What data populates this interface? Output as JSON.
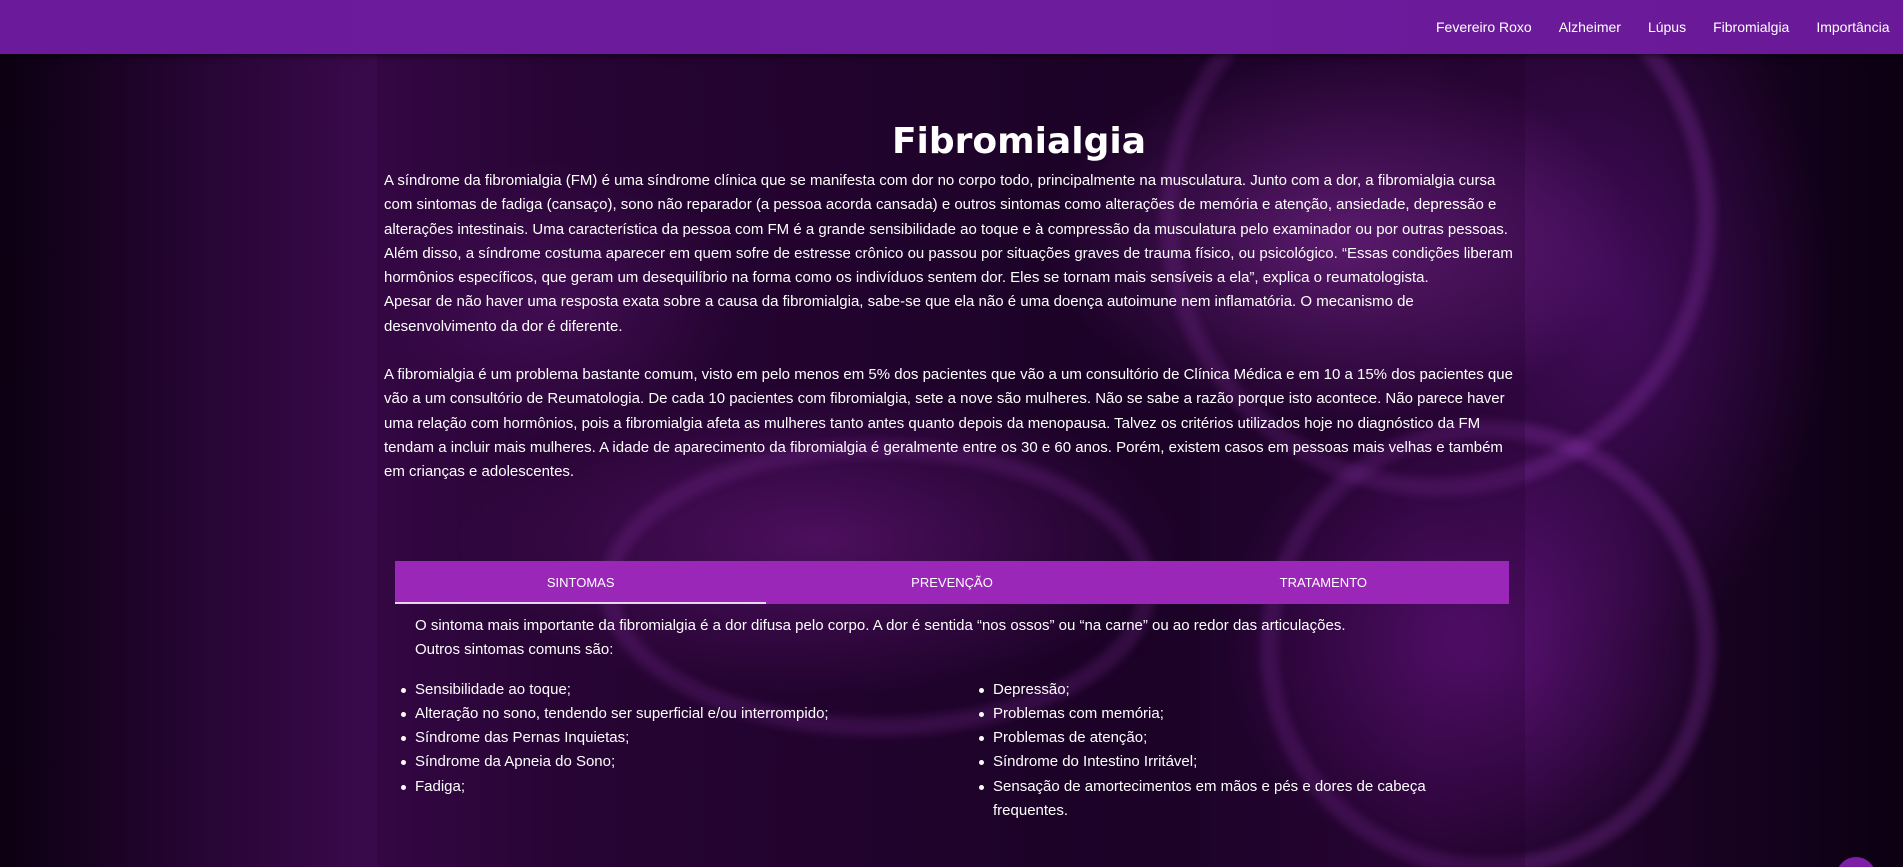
{
  "nav": {
    "items": [
      {
        "label": "Fevereiro Roxo"
      },
      {
        "label": "Alzheimer"
      },
      {
        "label": "Lúpus"
      },
      {
        "label": "Fibromialgia"
      },
      {
        "label": "Importância"
      }
    ]
  },
  "page": {
    "title": "Fibromialgia",
    "paragraphs": [
      "A síndrome da fibromialgia (FM) é uma síndrome clínica que se manifesta com dor no corpo todo, principalmente na musculatura. Junto com a dor, a fibromialgia cursa com sintomas de fadiga (cansaço), sono não reparador (a pessoa acorda cansada) e outros sintomas como alterações de memória e atenção, ansiedade, depressão e alterações intestinais. Uma característica da pessoa com FM é a grande sensibilidade ao toque e à compressão da musculatura pelo examinador ou por outras pessoas.",
      "Além disso, a síndrome costuma aparecer em quem sofre de estresse crônico ou passou por situações graves de trauma físico, ou psicológico. “Essas condições liberam hormônios específicos, que geram um desequilíbrio na forma como os indivíduos sentem dor. Eles se tornam mais sensíveis a ela”, explica o reumatologista.",
      "Apesar de não haver uma resposta exata sobre a causa da fibromialgia, sabe-se que ela não é uma doença autoimune nem inflamatória. O mecanismo de desenvolvimento da dor é diferente.",
      "A fibromialgia é um problema bastante comum, visto em pelo menos em 5% dos pacientes que vão a um consultório de Clínica Médica e em 10 a 15% dos pacientes que vão a um consultório de Reumatologia. De cada 10 pacientes com fibromialgia, sete a nove são mulheres. Não se sabe a razão porque isto acontece. Não parece haver uma relação com hormônios, pois a fibromialgia afeta as mulheres tanto antes quanto depois da menopausa. Talvez os critérios utilizados hoje no diagnóstico da FM tendam a incluir mais mulheres. A idade de aparecimento da fibromialgia é geralmente entre os 30 e 60 anos. Porém, existem casos em pessoas mais velhas e também em crianças e adolescentes."
    ]
  },
  "tabs": {
    "items": [
      {
        "label": "SINTOMAS",
        "active": true
      },
      {
        "label": "PREVENÇÃO",
        "active": false
      },
      {
        "label": "TRATAMENTO",
        "active": false
      }
    ],
    "sintomas": {
      "intro_line1": "O sintoma mais importante da fibromialgia é a dor difusa pelo corpo. A dor é sentida “nos ossos” ou “na carne” ou ao redor das articulações.",
      "intro_line2": "Outros sintomas comuns são:",
      "left": [
        "Sensibilidade ao toque;",
        "Alteração no sono, tendendo ser superficial e/ou interrompido;",
        "Síndrome das Pernas Inquietas;",
        "Síndrome da Apneia do Sono;",
        "Fadiga;"
      ],
      "right": [
        "Depressão;",
        "Problemas com memória;",
        "Problemas de atenção;",
        "Síndrome do Intestino Irritável;",
        "Sensação de amortecimentos em mãos e pés e dores de cabeça frequentes."
      ]
    }
  },
  "colors": {
    "navbar": "#6a1a9a",
    "tab_bar": "#9a27b8",
    "text": "#ffffff"
  }
}
